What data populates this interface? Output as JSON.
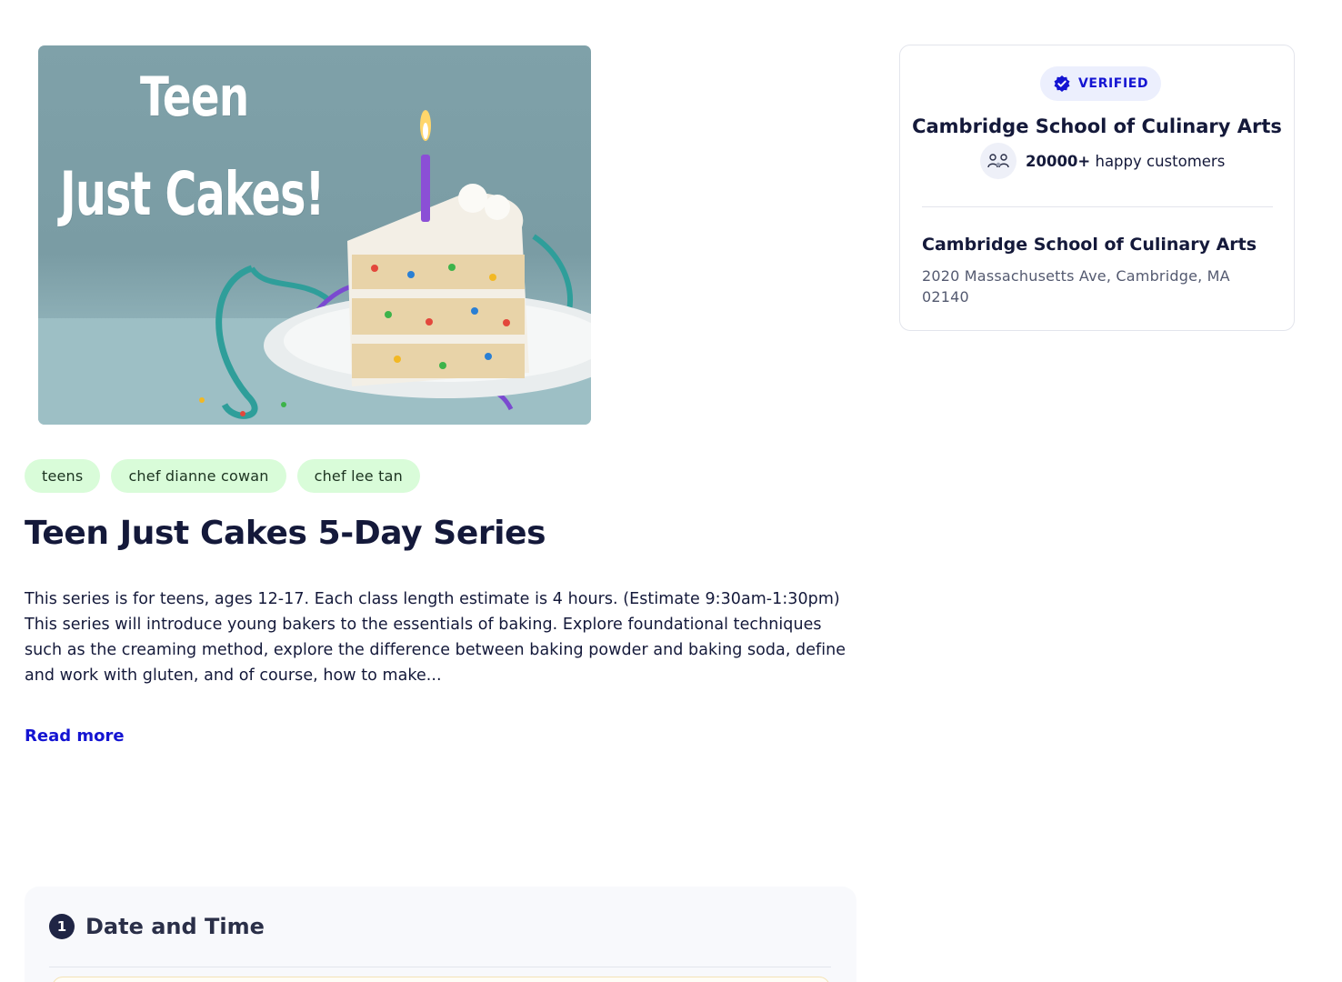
{
  "hero": {
    "title_line1": "Teen",
    "title_line2": "Just Cakes!"
  },
  "tags": [
    "teens",
    "chef dianne cowan",
    "chef lee tan"
  ],
  "class": {
    "title": "Teen Just Cakes 5-Day Series",
    "description_line1": "This series is for teens, ages 12-17. Each class length estimate is 4 hours. (Estimate 9:30am-1:30pm)",
    "description_line2": "This series will introduce young bakers to the essentials of baking. Explore foundational techniques such as the creaming method, explore the difference between baking powder and baking soda, define and work with gluten, and of course, how to make...",
    "read_more": "Read more"
  },
  "date_section": {
    "step": "1",
    "title": "Date and Time"
  },
  "provider": {
    "verified_label": "VERIFIED",
    "name": "Cambridge School of Culinary Arts",
    "customers_count": "20000+",
    "customers_label": "happy customers",
    "location_name": "Cambridge School of Culinary Arts",
    "address": "2020 Massachusetts Ave, Cambridge, MA 02140"
  },
  "colors": {
    "accent": "#1414d2",
    "tag_bg": "#d9fcd9",
    "verified_bg": "#eceffd",
    "text": "#14193a"
  },
  "icons": {
    "verified": "verified-badge-icon",
    "customers": "users-icon"
  }
}
